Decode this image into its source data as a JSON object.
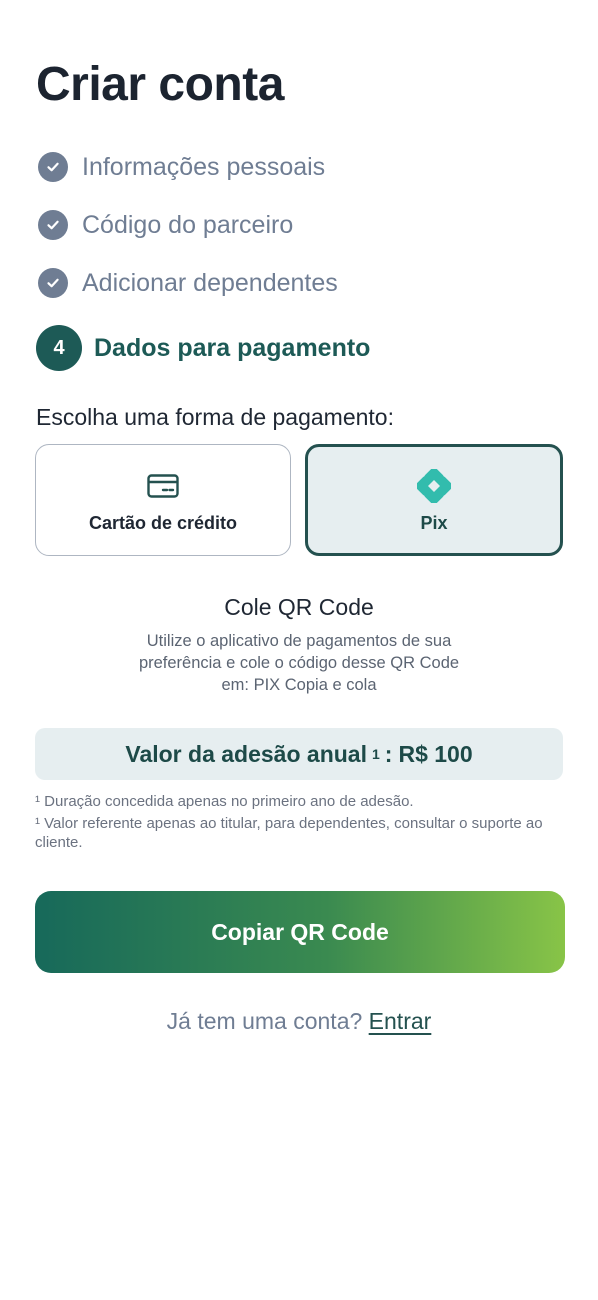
{
  "page": {
    "title": "Criar conta"
  },
  "steps": [
    {
      "label": "Informações pessoais",
      "status": "completed"
    },
    {
      "label": "Código do parceiro",
      "status": "completed"
    },
    {
      "label": "Adicionar dependentes",
      "status": "completed"
    },
    {
      "number": "4",
      "label": "Dados para pagamento",
      "status": "current"
    }
  ],
  "payment": {
    "prompt": "Escolha uma forma  de pagamento:",
    "options": [
      {
        "label": "Cartão de crédito",
        "icon": "credit-card-icon",
        "selected": false
      },
      {
        "label": "Pix",
        "icon": "pix-icon",
        "selected": true
      }
    ]
  },
  "qr": {
    "title": "Cole QR Code",
    "description": "Utilize o aplicativo de pagamentos de sua preferência e cole o código desse QR Code em: PIX Copia e cola"
  },
  "fee": {
    "label": "Valor da adesão anual",
    "marker": "1",
    "separator": ":",
    "value": "R$ 100"
  },
  "footnotes": [
    "¹ Duração concedida apenas no primeiro ano de adesão.",
    "¹ Valor referente apenas ao titular, para dependentes, consultar o suporte ao cliente."
  ],
  "actions": {
    "copy_label": "Copiar QR Code"
  },
  "login": {
    "prompt": "Já tem uma conta?",
    "link": "Entrar"
  },
  "colors": {
    "primary": "#1d5a56",
    "muted": "#6f7d93",
    "selected_bg": "#e6eef0",
    "gradient_start": "#17695a",
    "gradient_end": "#88c447",
    "pix": "#32bcad"
  }
}
